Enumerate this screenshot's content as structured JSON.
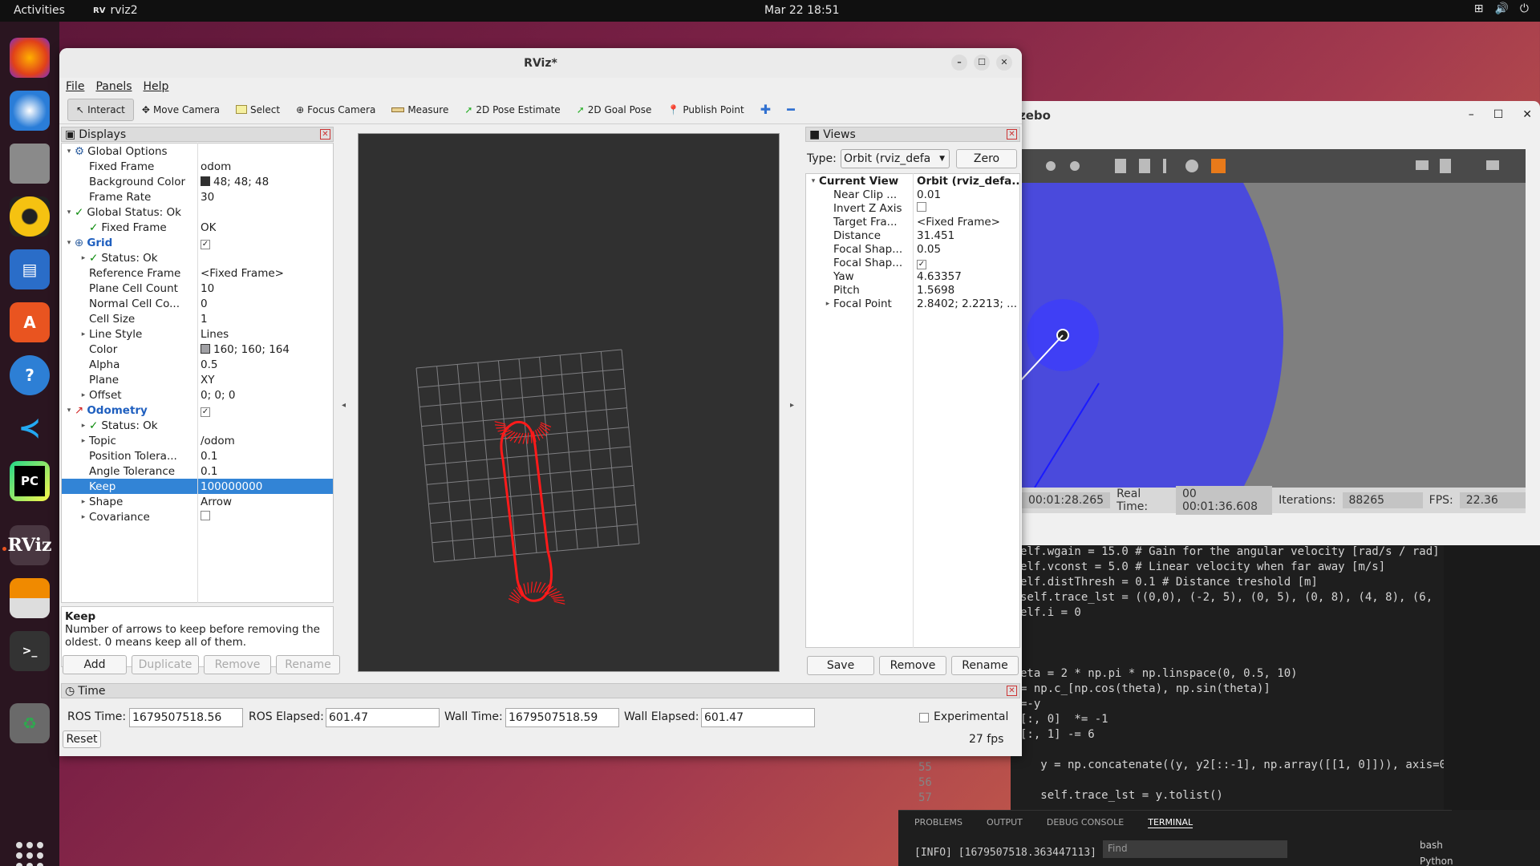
{
  "topbar": {
    "activities": "Activities",
    "app_name": "rviz2",
    "clock": "Mar 22  18:51"
  },
  "window": {
    "title": "RViz*"
  },
  "menu": [
    "File",
    "Panels",
    "Help"
  ],
  "toolbar": [
    "Interact",
    "Move Camera",
    "Select",
    "Focus Camera",
    "Measure",
    "2D Pose Estimate",
    "2D Goal Pose",
    "Publish Point"
  ],
  "displays": {
    "title": "Displays",
    "rows": [
      {
        "k": "Global Options",
        "v": "",
        "lvl": 0,
        "arrow": "▾",
        "icon": "gear"
      },
      {
        "k": "Fixed Frame",
        "v": "odom",
        "lvl": 1
      },
      {
        "k": "Background Color",
        "v": "48; 48; 48",
        "lvl": 1,
        "swatch": "#303030"
      },
      {
        "k": "Frame Rate",
        "v": "30",
        "lvl": 1
      },
      {
        "k": "Global Status: Ok",
        "v": "",
        "lvl": 0,
        "arrow": "▾",
        "check": true
      },
      {
        "k": "Fixed Frame",
        "v": "OK",
        "lvl": 1,
        "check": true
      },
      {
        "k": "Grid",
        "v": "",
        "lvl": 0,
        "arrow": "▾",
        "blue": true,
        "cb": true,
        "icon": "grid"
      },
      {
        "k": "Status: Ok",
        "v": "",
        "lvl": 1,
        "arrow": "▸",
        "check": true
      },
      {
        "k": "Reference Frame",
        "v": "<Fixed Frame>",
        "lvl": 1
      },
      {
        "k": "Plane Cell Count",
        "v": "10",
        "lvl": 1
      },
      {
        "k": "Normal Cell Co...",
        "v": "0",
        "lvl": 1
      },
      {
        "k": "Cell Size",
        "v": "1",
        "lvl": 1
      },
      {
        "k": "Line Style",
        "v": "Lines",
        "lvl": 1,
        "arrow": "▸"
      },
      {
        "k": "Color",
        "v": "160; 160; 164",
        "lvl": 1,
        "swatch": "#a0a0a4"
      },
      {
        "k": "Alpha",
        "v": "0.5",
        "lvl": 1
      },
      {
        "k": "Plane",
        "v": "XY",
        "lvl": 1
      },
      {
        "k": "Offset",
        "v": "0; 0; 0",
        "lvl": 1,
        "arrow": "▸"
      },
      {
        "k": "Odometry",
        "v": "",
        "lvl": 0,
        "arrow": "▾",
        "blue": true,
        "cb": true,
        "icon": "odom"
      },
      {
        "k": "Status: Ok",
        "v": "",
        "lvl": 1,
        "arrow": "▸",
        "check": true
      },
      {
        "k": "Topic",
        "v": "/odom",
        "lvl": 1,
        "arrow": "▸"
      },
      {
        "k": "Position Tolera...",
        "v": "0.1",
        "lvl": 1
      },
      {
        "k": "Angle Tolerance",
        "v": "0.1",
        "lvl": 1
      },
      {
        "k": "Keep",
        "v": "100000000",
        "lvl": 1,
        "sel": true
      },
      {
        "k": "Shape",
        "v": "Arrow",
        "lvl": 1,
        "arrow": "▸"
      },
      {
        "k": "Covariance",
        "v": "",
        "lvl": 1,
        "arrow": "▸",
        "cb2": true
      }
    ],
    "help_title": "Keep",
    "help_text": "Number of arrows to keep before removing the oldest. 0 means keep all of them.",
    "buttons": [
      "Add",
      "Duplicate",
      "Remove",
      "Rename"
    ]
  },
  "views": {
    "title": "Views",
    "type_label": "Type:",
    "type_value": "Orbit (rviz_defa",
    "zero": "Zero",
    "rows": [
      {
        "k": "Current View",
        "v": "Orbit (rviz_defa...",
        "bold": true,
        "arrow": "▾"
      },
      {
        "k": "Near Clip ...",
        "v": "0.01"
      },
      {
        "k": "Invert Z Axis",
        "v": "",
        "cb": true
      },
      {
        "k": "Target Fra...",
        "v": "<Fixed Frame>"
      },
      {
        "k": "Distance",
        "v": "31.451"
      },
      {
        "k": "Focal Shap...",
        "v": "0.05"
      },
      {
        "k": "Focal Shap...",
        "v": "",
        "cb": true,
        "checked": true
      },
      {
        "k": "Yaw",
        "v": "4.63357"
      },
      {
        "k": "Pitch",
        "v": "1.5698"
      },
      {
        "k": "Focal Point",
        "v": "2.8402; 2.2213; ...",
        "arrow": "▸"
      }
    ],
    "buttons": [
      "Save",
      "Remove",
      "Rename"
    ]
  },
  "time": {
    "title": "Time",
    "ros_time_label": "ROS Time:",
    "ros_time": "1679507518.56",
    "ros_elapsed_label": "ROS Elapsed:",
    "ros_elapsed": "601.47",
    "wall_time_label": "Wall Time:",
    "wall_time": "1679507518.59",
    "wall_elapsed_label": "Wall Elapsed:",
    "wall_elapsed": "601.47",
    "experimental": "Experimental",
    "fps": "27 fps",
    "reset": "Reset"
  },
  "gazebo": {
    "title": "zebo",
    "sim_time": "00:01:28.265",
    "real_time_label": "Real Time:",
    "real_time": "00 00:01:36.608",
    "iter_label": "Iterations:",
    "iterations": "88265",
    "fps_label": "FPS:",
    "fps": "22.36"
  },
  "vscode": {
    "code": [
      "elf.wgain = 15.0 # Gain for the angular velocity [rad/s / rad]",
      "elf.vconst = 5.0 # Linear velocity when far away [m/s]",
      "elf.distThresh = 0.1 # Distance treshold [m]",
      "self.trace_lst = ((0,0), (-2, 5), (0, 5), (0, 8), (4, 8), (6,",
      "elf.i = 0",
      "",
      "",
      "",
      "eta = 2 * np.pi * np.linspace(0, 0.5, 10)",
      "= np.c_[np.cos(theta), np.sin(theta)]",
      "=-y",
      "[:, 0]  *= -1",
      "[:, 1] -= 6",
      "",
      "   y = np.concatenate((y, y2[::-1], np.array([[1, 0]])), axis=0)",
      "",
      "   self.trace_lst = y.tolist()"
    ],
    "line_numbers": [
      "55",
      "56",
      "57"
    ],
    "tabs": [
      "PROBLEMS",
      "OUTPUT",
      "DEBUG CONSOLE",
      "TERMINAL"
    ],
    "terminal": "[INFO] [1679507518.363447113]",
    "find": "Find",
    "term_items": [
      "bash",
      "Python"
    ]
  }
}
